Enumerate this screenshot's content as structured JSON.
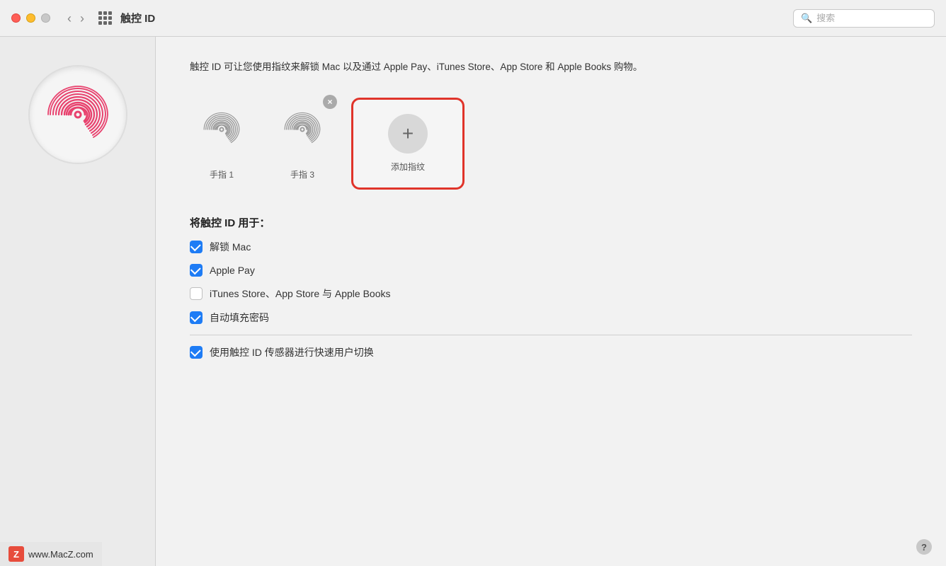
{
  "titlebar": {
    "title": "触控 ID",
    "search_placeholder": "搜索",
    "nav_back": "‹",
    "nav_forward": "›"
  },
  "sidebar": {
    "watermark_logo": "Z",
    "watermark_url": "www.MacZ.com"
  },
  "detail": {
    "description": "触控 ID 可让您使用指纹来解锁 Mac 以及通过 Apple Pay、iTunes Store、App Store 和 Apple Books 购物。",
    "fingerprints": [
      {
        "label": "手指 1",
        "has_delete": false
      },
      {
        "label": "手指 3",
        "has_delete": true
      }
    ],
    "add_label": "添加指纹",
    "add_plus": "+",
    "usage_title": "将触控 ID 用于：",
    "checkboxes": [
      {
        "label": "解锁 Mac",
        "checked": true
      },
      {
        "label": "Apple Pay",
        "checked": true
      },
      {
        "label": "iTunes Store、App Store 与 Apple Books",
        "checked": false
      },
      {
        "label": "自动填充密码",
        "checked": true
      }
    ],
    "bottom_checkbox_label": "使用触控 ID 传感器进行快速用户切换",
    "bottom_checkbox_checked": true,
    "help_label": "?"
  }
}
